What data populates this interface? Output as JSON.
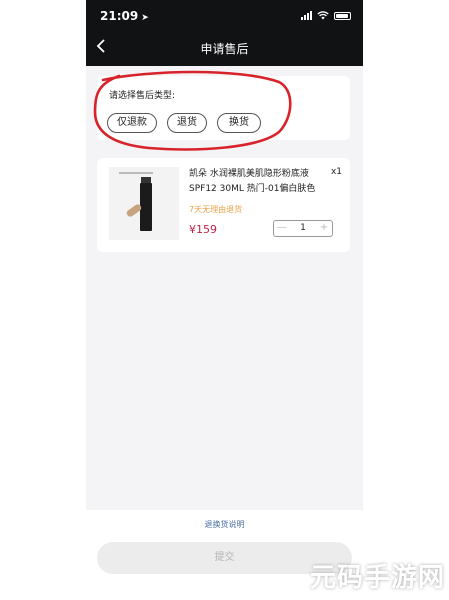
{
  "status_bar": {
    "time": "21:09"
  },
  "nav": {
    "title": "申请售后"
  },
  "service_type": {
    "title": "请选择售后类型:",
    "options": [
      "仅退款",
      "退货",
      "换货"
    ]
  },
  "product": {
    "name": "凯朵 水润裸肌美肌隐形粉底液 SPF12 30ML 热门-01偏白肤色",
    "quantity_label": "x1",
    "tag": "7天无理由退货",
    "price": "¥159",
    "stepper": {
      "minus": "—",
      "value": "1",
      "plus": "+"
    }
  },
  "footer": {
    "policy_link": "退换货说明",
    "submit_label": "提交"
  },
  "watermark": "元码手游网",
  "colors": {
    "nav_bg": "#111214",
    "price": "#c0264a",
    "tag": "#e8a24a",
    "annotation": "#d8232a",
    "link": "#4a6fa5"
  }
}
